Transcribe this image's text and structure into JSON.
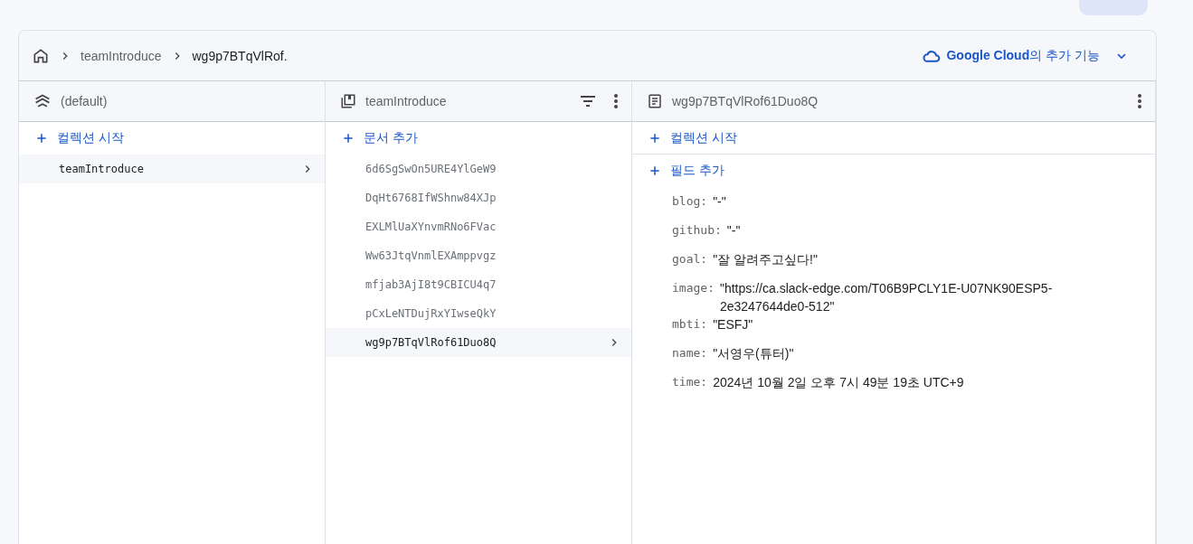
{
  "top_bar": {
    "view_buttons": [
      {
        "selected": true
      }
    ]
  },
  "breadcrumb": [
    "teamIntroduce",
    "wg9p7BTqVlRof."
  ],
  "cloud_menu": {
    "brand": "Google Cloud",
    "label": "의 추가 기능"
  },
  "columns": [
    {
      "kind": "database",
      "title": "(default)",
      "add_label": "컬렉션 시작",
      "items": [
        {
          "label": "teamIntroduce",
          "selected": true
        }
      ]
    },
    {
      "kind": "collection",
      "title": "teamIntroduce",
      "add_label": "문서 추가",
      "items": [
        {
          "label": "6d6SgSwOn5URE4YlGeW9",
          "selected": false
        },
        {
          "label": "DqHt6768IfWShnw84XJp",
          "selected": false
        },
        {
          "label": "EXLMlUaXYnvmRNo6FVac",
          "selected": false
        },
        {
          "label": "Ww63JtqVnmlEXAmppvgz",
          "selected": false
        },
        {
          "label": "mfjab3AjI8t9CBICU4q7",
          "selected": false
        },
        {
          "label": "pCxLeNTDujRxYIwseQkY",
          "selected": false
        },
        {
          "label": "wg9p7BTqVlRof61Duo8Q",
          "selected": true
        }
      ]
    },
    {
      "kind": "document",
      "title": "wg9p7BTqVlRof61Duo8Q",
      "add_label": "컬렉션 시작",
      "add_field_label": "필드 추가",
      "fields": [
        {
          "key": "blog:",
          "value": "\"-\""
        },
        {
          "key": "github:",
          "value": "\"-\""
        },
        {
          "key": "goal:",
          "value": "\"잘 알려주고싶다!\""
        },
        {
          "key": "image:",
          "value": "\"https://ca.slack-edge.com/T06B9PCLY1E-U07NK90ESP5-2e3247644de0-512\""
        },
        {
          "key": "mbti:",
          "value": "\"ESFJ\""
        },
        {
          "key": "name:",
          "value": "\"서영우(튜터)\""
        },
        {
          "key": "time:",
          "value": "2024년 10월 2일 오후 7시 49분 19초 UTC+9"
        }
      ]
    }
  ]
}
